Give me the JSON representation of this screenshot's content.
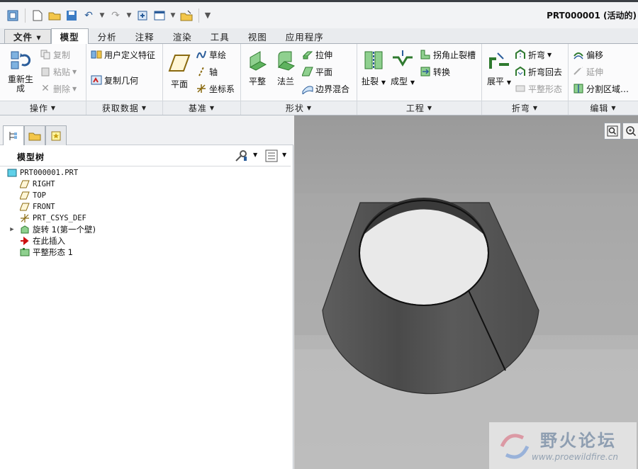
{
  "window": {
    "title": "PRT000001 (活动的)"
  },
  "tabs": [
    "文件 ▾",
    "模型",
    "分析",
    "注释",
    "渲染",
    "工具",
    "视图",
    "应用程序"
  ],
  "ribbon": {
    "groups": {
      "operations": "操作",
      "get_data": "获取数据",
      "datum": "基准",
      "shapes": "形状",
      "engineering": "工程",
      "bends": "折弯",
      "editing": "编辑"
    },
    "operations": {
      "regenerate": "重新生成",
      "copy": "复制",
      "paste": "粘贴",
      "delete": "删除"
    },
    "get_data": {
      "udf": "用户定义特征",
      "copy_geometry": "复制几何"
    },
    "datum": {
      "plane": "平面",
      "sketch": "草绘",
      "axis": "轴",
      "csys": "坐标系"
    },
    "shapes": {
      "flat": "平整",
      "flange": "法兰",
      "extrude": "拉伸",
      "planar": "平面",
      "boundary_blend": "边界混合"
    },
    "engineering": {
      "rip": "扯裂",
      "form": "成型",
      "corner_relief": "拐角止裂槽",
      "convert": "转换"
    },
    "bends": {
      "unbend": "展平",
      "bend": "折弯",
      "bend_back": "折弯回去",
      "flat_pattern": "平整形态"
    },
    "editing": {
      "offset": "偏移",
      "extend": "延伸",
      "split_area": "分割区域…"
    }
  },
  "model_tree": {
    "title": "模型树",
    "items": [
      {
        "label": "PRT000001.PRT"
      },
      {
        "label": "RIGHT"
      },
      {
        "label": "TOP"
      },
      {
        "label": "FRONT"
      },
      {
        "label": "PRT_CSYS_DEF"
      },
      {
        "label": "旋转 1(第一个壁)"
      },
      {
        "label": "在此插入"
      },
      {
        "label": "平整形态 1"
      }
    ]
  },
  "watermark": {
    "title": "野火论坛",
    "url": "www.proewildfire.cn"
  },
  "colors": {
    "accent": "#2b5d9a",
    "insert_arrow": "#cc1111",
    "viewport_bg": "#a6a6a6"
  },
  "icons": [
    "regenerate-icon",
    "copy-icon",
    "paste-icon",
    "delete-icon",
    "udf-icon",
    "copy-geometry-icon",
    "plane-icon",
    "sketch-icon",
    "axis-icon",
    "csys-icon",
    "flat-wall-icon",
    "flange-icon",
    "extrude-icon",
    "planar-icon",
    "boundary-blend-icon",
    "rip-icon",
    "form-icon",
    "corner-relief-icon",
    "convert-icon",
    "unbend-icon",
    "bend-icon",
    "bend-back-icon",
    "flat-pattern-icon",
    "offset-icon",
    "extend-icon",
    "split-area-icon"
  ]
}
